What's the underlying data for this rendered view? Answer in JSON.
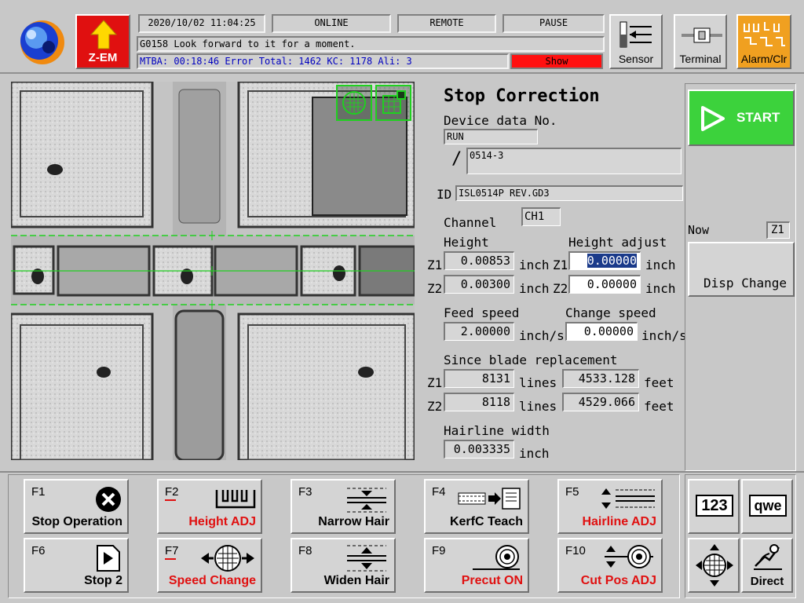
{
  "header": {
    "zem_label": "Z-EM",
    "datetime": "2020/10/02 11:04:25",
    "status_online": "ONLINE",
    "status_remote": "REMOTE",
    "status_pause": "PAUSE",
    "message": "G0158  Look forward to it for a moment.",
    "info_line": "MTBA: 00:18:46 Error Total: 1462 KC: 1178 Ali: 3",
    "show_label": "Show",
    "sensor_label": "Sensor",
    "terminal_label": "Terminal",
    "alarm_label": "Alarm/Clr"
  },
  "panel": {
    "title": "Stop Correction",
    "device_data_label": "Device data No.",
    "run_value": "RUN",
    "slash": "/",
    "device_value": "0514-3",
    "id_label": "ID",
    "id_value": "ISL0514P REV.GD3",
    "channel_label": "Channel",
    "channel_value": "CH1",
    "height_label": "Height",
    "height_adjust_label": "Height adjust",
    "z1": "Z1",
    "z2": "Z2",
    "height_z1": "0.00853",
    "height_z2": "0.00300",
    "height_adj_z1": "0.00000",
    "height_adj_z2": "0.00000",
    "inch": "inch",
    "feed_speed_label": "Feed speed",
    "feed_speed": "2.00000",
    "change_speed_label": "Change speed",
    "change_speed": "0.00000",
    "inch_s": "inch/s",
    "blade_label": "Since blade replacement",
    "lines_z1": "8131",
    "lines_z2": "8118",
    "lines": "lines",
    "feet_z1": "4533.128",
    "feet_z2": "4529.066",
    "feet": "feet",
    "hairline_label": "Hairline width",
    "hairline_value": "0.003335"
  },
  "right": {
    "start_label": "START",
    "now_label": "Now",
    "now_value": "Z1",
    "disp_change_label": "Disp Change",
    "num_label": "123",
    "kbd_label": "qwe",
    "direct_label": "Direct"
  },
  "fkeys": [
    {
      "key": "F1",
      "label": "Stop Operation",
      "red": false
    },
    {
      "key": "F2",
      "label": "Height ADJ",
      "red": true
    },
    {
      "key": "F3",
      "label": "Narrow Hair",
      "red": false
    },
    {
      "key": "F4",
      "label": "KerfC Teach",
      "red": false
    },
    {
      "key": "F5",
      "label": "Hairline ADJ",
      "red": true
    },
    {
      "key": "F6",
      "label": "Stop 2",
      "red": false
    },
    {
      "key": "F7",
      "label": "Speed Change",
      "red": true
    },
    {
      "key": "F8",
      "label": "Widen Hair",
      "red": false
    },
    {
      "key": "F9",
      "label": "Precut ON",
      "red": true
    },
    {
      "key": "F10",
      "label": "Cut Pos ADJ",
      "red": true
    }
  ],
  "colors": {
    "start_green": "#3cd23c",
    "alarm_orange": "#f0a020",
    "zem_red": "#e01010",
    "show_red": "#ff1010",
    "info_blue": "#0000c0"
  }
}
